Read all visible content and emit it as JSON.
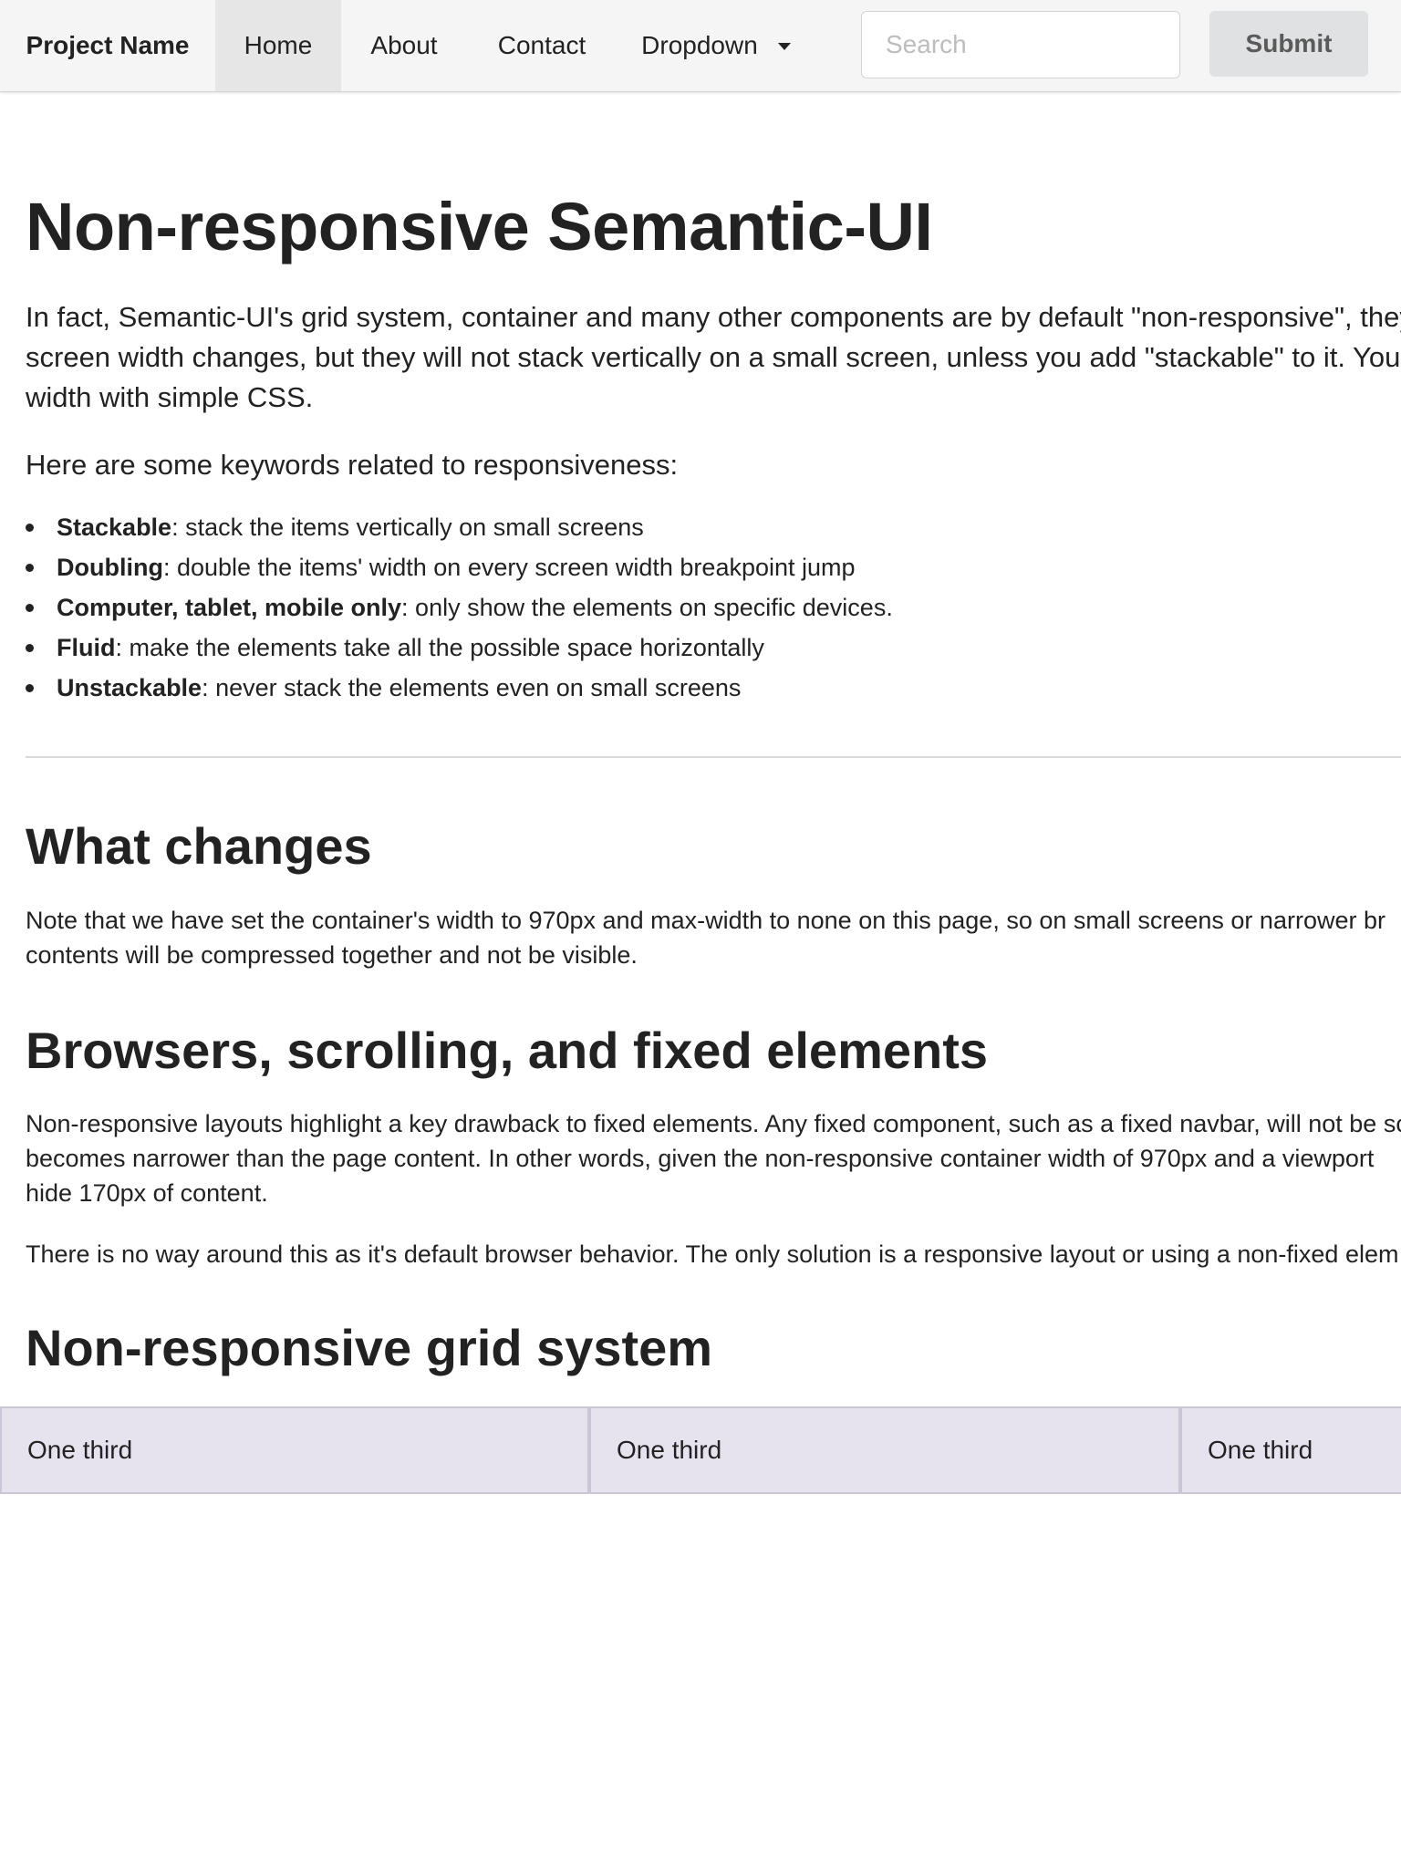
{
  "navbar": {
    "brand": "Project Name",
    "items": [
      {
        "label": "Home",
        "active": true
      },
      {
        "label": "About"
      },
      {
        "label": "Contact"
      },
      {
        "label": "Dropdown"
      }
    ],
    "search_placeholder": "Search",
    "submit_label": "Submit"
  },
  "main": {
    "title": "Non-responsive Semantic-UI",
    "intro_lines": [
      "In fact, Semantic-UI's grid system, container and many other components are by default \"non-responsive\", they",
      "screen width changes, but they will not stack vertically on a small screen, unless you add \"stackable\" to it. You",
      "width with simple CSS."
    ],
    "keywords_intro": "Here are some keywords related to responsiveness:",
    "keywords": [
      {
        "term": "Stackable",
        "desc": ": stack the items vertically on small screens"
      },
      {
        "term": "Doubling",
        "desc": ": double the items' width on every screen width breakpoint jump"
      },
      {
        "term": "Computer, tablet, mobile only",
        "desc": ": only show the elements on specific devices."
      },
      {
        "term": "Fluid",
        "desc": ": make the elements take all the possible space horizontally"
      },
      {
        "term": "Unstackable",
        "desc": ": never stack the elements even on small screens"
      }
    ],
    "sections": {
      "what_changes": {
        "heading": "What changes",
        "lines": [
          "Note that we have set the container's width to 970px and max-width to none on this page, so on small screens or narrower br",
          "contents will be compressed together and not be visible."
        ]
      },
      "browsers": {
        "heading": "Browsers, scrolling, and fixed elements",
        "p1_lines": [
          "Non-responsive layouts highlight a key drawback to fixed elements. Any fixed component, such as a fixed navbar, will not be sc",
          "becomes narrower than the page content. In other words, given the non-responsive container width of 970px and a viewport",
          "hide 170px of content."
        ],
        "p2_lines": [
          "There is no way around this as it's default browser behavior. The only solution is a responsive layout or using a non-fixed elem"
        ]
      },
      "grid": {
        "heading": "Non-responsive grid system",
        "cells": [
          "One third",
          "One third",
          "One third"
        ]
      }
    }
  },
  "colors": {
    "navbar_bg": "#f5f5f5",
    "nav_active_bg": "#e6e6e6",
    "button_bg": "#e0e1e2",
    "grid_cell_bg": "#e6e3ee",
    "grid_cell_border": "#c9c6d6",
    "text": "#222222"
  }
}
